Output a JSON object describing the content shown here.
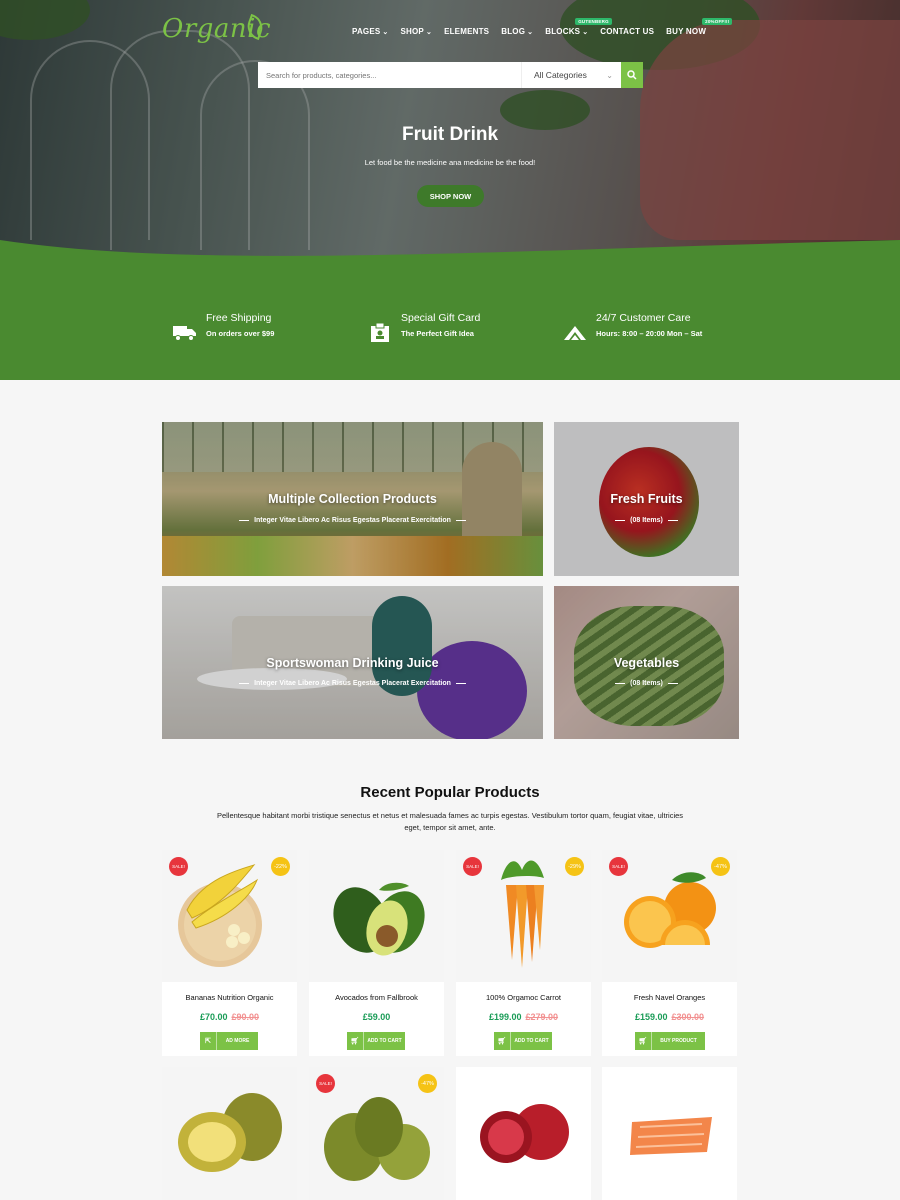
{
  "brand": {
    "logo": "Organic",
    "accent": "#7cc246",
    "dark_green": "#4a8a30"
  },
  "nav": {
    "items": [
      {
        "label": "PAGES",
        "dropdown": true
      },
      {
        "label": "SHOP",
        "dropdown": true
      },
      {
        "label": "ELEMENTS",
        "dropdown": false
      },
      {
        "label": "BLOG",
        "dropdown": true
      },
      {
        "label": "BLOCKS",
        "dropdown": true,
        "badge": "GUTENBERG"
      },
      {
        "label": "CONTACT US",
        "dropdown": false
      },
      {
        "label": "BUY NOW",
        "dropdown": false,
        "badge": "20%OFF!!!"
      }
    ]
  },
  "search": {
    "placeholder": "Search for products, categories...",
    "category": "All Categories",
    "icon": "search-icon"
  },
  "hero": {
    "title": "Fruit Drink",
    "subtitle": "Let food be the medicine ana medicine be the food!",
    "button": "SHOP NOW"
  },
  "features": [
    {
      "icon": "truck-icon",
      "title": "Free Shipping",
      "subtitle": "On orders over $99"
    },
    {
      "icon": "gift-card-icon",
      "title": "Special Gift Card",
      "subtitle": "The Perfect Gift Idea"
    },
    {
      "icon": "customer-care-icon",
      "title": "24/7 Customer Care",
      "subtitle": "Hours: 8:00 – 20:00 Mon – Sat"
    }
  ],
  "collections": [
    {
      "title": "Multiple Collection Products",
      "subtitle": "Integer Vitae Libero Ac Risus Egestas Placerat Exercitation"
    },
    {
      "title": "Fresh Fruits",
      "subtitle": "(08 Items)"
    },
    {
      "title": "Sportswoman Drinking Juice",
      "subtitle": "Integer Vitae Libero Ac Risus Egestas Placerat Exercitation"
    },
    {
      "title": "Vegetables",
      "subtitle": "(08 Items)"
    }
  ],
  "products_section": {
    "title": "Recent Popular Products",
    "description": "Pellentesque habitant morbi tristique senectus et netus et malesuada fames ac turpis egestas. Vestibulum tortor quam, feugiat vitae, ultricies eget, tempor sit amet, ante."
  },
  "products": [
    {
      "name": "Bananas Nutrition Organic",
      "price": "£70.00",
      "old_price": "£90.00",
      "sale": "SALE!",
      "discount": "-22%",
      "action": "AD MORE",
      "action_icon": "external-icon"
    },
    {
      "name": "Avocados from Fallbrook",
      "price": "£59.00",
      "old_price": "",
      "sale": "",
      "discount": "",
      "action": "ADD TO CART",
      "action_icon": "cart-icon"
    },
    {
      "name": "100% Orgamoc Carrot",
      "price": "£199.00",
      "old_price": "£279.00",
      "sale": "SALE!",
      "discount": "-29%",
      "action": "ADD TO CART",
      "action_icon": "cart-icon"
    },
    {
      "name": "Fresh Navel Oranges",
      "price": "£159.00",
      "old_price": "£300.00",
      "sale": "SALE!",
      "discount": "-47%",
      "action": "BUY PRODUCT",
      "action_icon": "cart-icon"
    }
  ],
  "products_row2": [
    {
      "sale": "",
      "discount": ""
    },
    {
      "sale": "SALE!",
      "discount": "-47%"
    },
    {
      "sale": "",
      "discount": ""
    },
    {
      "sale": "",
      "discount": ""
    }
  ]
}
